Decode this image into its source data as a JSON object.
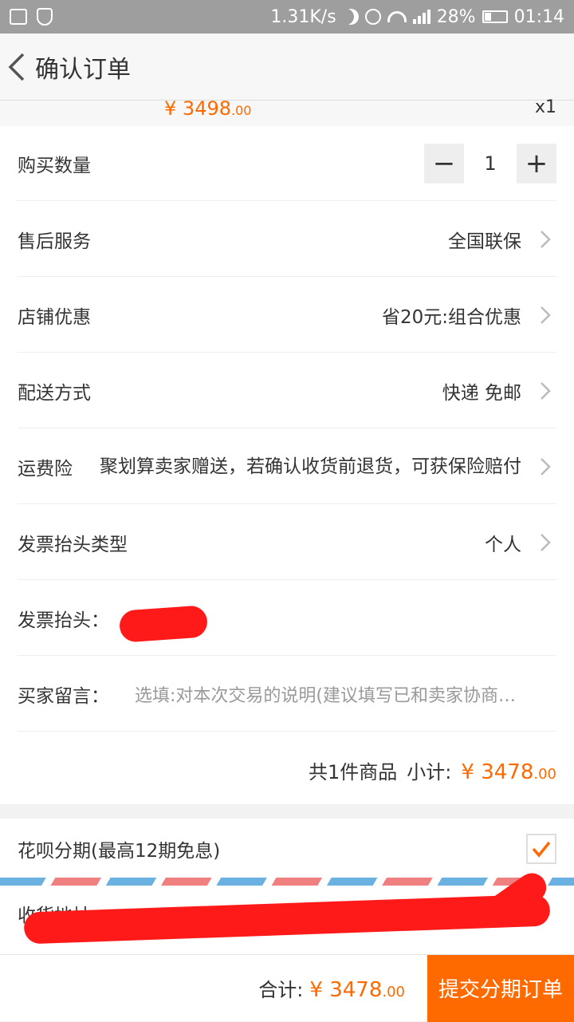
{
  "status_bar": {
    "speed": "1.31K/s",
    "battery": "28%",
    "time": "01:14"
  },
  "header": {
    "title": "确认订单"
  },
  "item_summary": {
    "price_symbol": "¥",
    "price_int": "3498",
    "price_dec": ".00",
    "quantity": "x1"
  },
  "rows": {
    "quantity_label": "购买数量",
    "quantity_value": "1",
    "after_sales_label": "售后服务",
    "after_sales_value": "全国联保",
    "shop_discount_label": "店铺优惠",
    "shop_discount_value": "省20元:组合优惠",
    "delivery_label": "配送方式",
    "delivery_value": "快递 免邮",
    "shipping_insurance_label": "运费险",
    "shipping_insurance_value": "聚划算卖家赠送，若确认收货前退货，可获保险赔付",
    "invoice_type_label": "发票抬头类型",
    "invoice_type_value": "个人",
    "invoice_title_label": "发票抬头：",
    "note_label": "买家留言：",
    "note_placeholder": "选填:对本次交易的说明(建议填写已和卖家协商…"
  },
  "subtotal": {
    "count_text": "共1件商品",
    "label": "小计:",
    "symbol": "¥",
    "amount_int": "3478",
    "amount_dec": ".00"
  },
  "huabei": {
    "label": "花呗分期(最高12期免息)",
    "checked": true
  },
  "address": {
    "label": "收货地址："
  },
  "footer": {
    "total_label": "合计:",
    "symbol": "¥",
    "amount_int": "3478",
    "amount_dec": ".00",
    "submit_label": "提交分期订单"
  },
  "colors": {
    "accent": "#ff6a00",
    "redaction": "#ff1a1a"
  }
}
